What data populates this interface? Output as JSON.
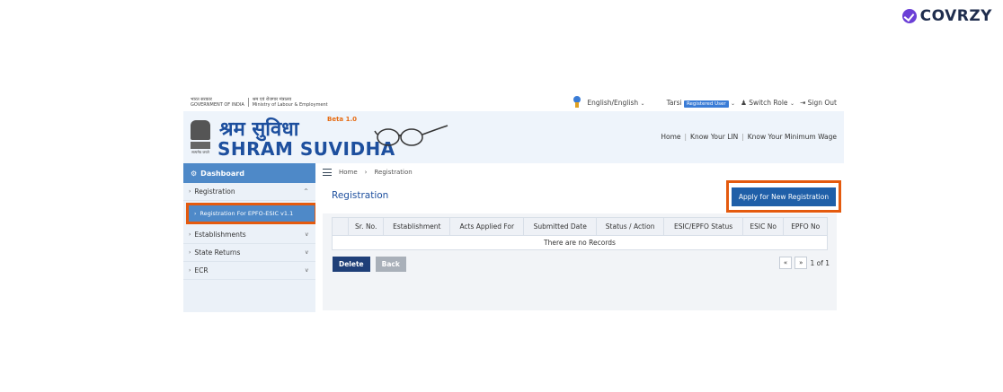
{
  "brand": {
    "name": "COVRZY"
  },
  "gov": {
    "line1a": "भारत सरकार",
    "line1b": "GOVERNMENT OF INDIA",
    "line2a": "श्रम एवं रोजगार मंत्रालय",
    "line2b": "Ministry of Labour & Employment"
  },
  "topbar": {
    "language": "English/English",
    "user_label": "Tarsi",
    "user_tag": "Registered User",
    "switch_role": "Switch Role",
    "sign_out": "Sign Out"
  },
  "header": {
    "title_hi": "श्रम सुविधा",
    "title_en": "SHRAM SUVIDHA",
    "beta": "Beta 1.0",
    "emblem_motto": "सत्यमेव जयते",
    "nav": [
      "Home",
      "Know Your LIN",
      "Know Your Minimum Wage"
    ]
  },
  "sidebar": {
    "dashboard": "Dashboard",
    "items": [
      {
        "label": "Registration",
        "caret": "^"
      },
      {
        "label": "Establishments",
        "caret": "v"
      },
      {
        "label": "State Returns",
        "caret": "v"
      },
      {
        "label": "ECR",
        "caret": "v"
      }
    ],
    "sub_item": "Registration For EPFO-ESIC v1.1"
  },
  "breadcrumb": {
    "home": "Home",
    "sep": "›",
    "current": "Registration"
  },
  "page": {
    "title": "Registration",
    "apply_button": "Apply for New Registration"
  },
  "table": {
    "headers": [
      "Sr. No.",
      "Establishment",
      "Acts Applied For",
      "Submitted Date",
      "Status / Action",
      "ESIC/EPFO Status",
      "ESIC No",
      "EPFO No"
    ],
    "empty": "There are no Records"
  },
  "actions": {
    "delete": "Delete",
    "back": "Back"
  },
  "pager": {
    "first": "«",
    "next": "»",
    "info": "1 of 1"
  }
}
